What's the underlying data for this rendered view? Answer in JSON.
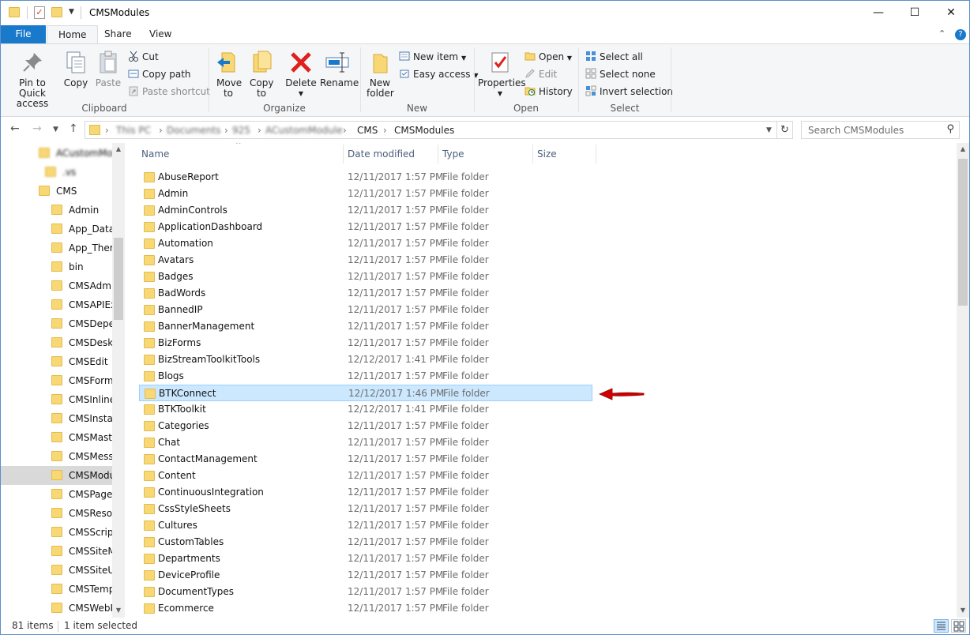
{
  "window": {
    "title": "CMSModules",
    "minimize": "—",
    "maximize": "☐",
    "close": "✕"
  },
  "tabs": {
    "file": "File",
    "home": "Home",
    "share": "Share",
    "view": "View"
  },
  "ribbon": {
    "clipboard": {
      "pin": "Pin to Quick access",
      "copy": "Copy",
      "paste": "Paste",
      "cut": "Cut",
      "copy_path": "Copy path",
      "paste_shortcut": "Paste shortcut",
      "label": "Clipboard"
    },
    "organize": {
      "move_to": "Move to",
      "copy_to": "Copy to",
      "delete": "Delete",
      "rename": "Rename",
      "label": "Organize"
    },
    "new": {
      "new_folder": "New folder",
      "new_item": "New item",
      "easy_access": "Easy access",
      "label": "New"
    },
    "open": {
      "properties": "Properties",
      "open": "Open",
      "edit": "Edit",
      "history": "History",
      "label": "Open"
    },
    "select": {
      "select_all": "Select all",
      "select_none": "Select none",
      "invert": "Invert selection",
      "label": "Select"
    }
  },
  "address": {
    "crumbs": [
      "This PC",
      "Documents",
      "925",
      "ACustomModule",
      "CMS",
      "CMSModules"
    ],
    "search_placeholder": "Search CMSModules"
  },
  "navpane": {
    "items": [
      {
        "label": "ACustomModu",
        "blurred": true
      },
      {
        "label": ".vs",
        "blurred": true
      },
      {
        "label": "CMS"
      },
      {
        "label": "Admin"
      },
      {
        "label": "App_Data"
      },
      {
        "label": "App_Themes"
      },
      {
        "label": "bin"
      },
      {
        "label": "CMSAdminControls"
      },
      {
        "label": "CMSAPIExamples"
      },
      {
        "label": "CMSDependencies"
      },
      {
        "label": "CMSDesk"
      },
      {
        "label": "CMSEdit"
      },
      {
        "label": "CMSFormControls"
      },
      {
        "label": "CMSInlineControls"
      },
      {
        "label": "CMSInstall"
      },
      {
        "label": "CMSMasterPages"
      },
      {
        "label": "CMSMessages"
      },
      {
        "label": "CMSModules",
        "selected": true
      },
      {
        "label": "CMSPages"
      },
      {
        "label": "CMSResources"
      },
      {
        "label": "CMSScripts"
      },
      {
        "label": "CMSSiteManager"
      },
      {
        "label": "CMSSiteUtils"
      },
      {
        "label": "CMSTemplates"
      },
      {
        "label": "CMSWebParts"
      }
    ]
  },
  "columns": {
    "name": "Name",
    "date": "Date modified",
    "type": "Type",
    "size": "Size"
  },
  "files": [
    {
      "name": "AbuseReport",
      "date": "12/11/2017 1:57 PM",
      "type": "File folder"
    },
    {
      "name": "Admin",
      "date": "12/11/2017 1:57 PM",
      "type": "File folder"
    },
    {
      "name": "AdminControls",
      "date": "12/11/2017 1:57 PM",
      "type": "File folder"
    },
    {
      "name": "ApplicationDashboard",
      "date": "12/11/2017 1:57 PM",
      "type": "File folder"
    },
    {
      "name": "Automation",
      "date": "12/11/2017 1:57 PM",
      "type": "File folder"
    },
    {
      "name": "Avatars",
      "date": "12/11/2017 1:57 PM",
      "type": "File folder"
    },
    {
      "name": "Badges",
      "date": "12/11/2017 1:57 PM",
      "type": "File folder"
    },
    {
      "name": "BadWords",
      "date": "12/11/2017 1:57 PM",
      "type": "File folder"
    },
    {
      "name": "BannedIP",
      "date": "12/11/2017 1:57 PM",
      "type": "File folder"
    },
    {
      "name": "BannerManagement",
      "date": "12/11/2017 1:57 PM",
      "type": "File folder"
    },
    {
      "name": "BizForms",
      "date": "12/11/2017 1:57 PM",
      "type": "File folder"
    },
    {
      "name": "BizStreamToolkitTools",
      "date": "12/12/2017 1:41 PM",
      "type": "File folder"
    },
    {
      "name": "Blogs",
      "date": "12/11/2017 1:57 PM",
      "type": "File folder"
    },
    {
      "name": "BTKConnect",
      "date": "12/12/2017 1:46 PM",
      "type": "File folder",
      "selected": true
    },
    {
      "name": "BTKToolkit",
      "date": "12/12/2017 1:41 PM",
      "type": "File folder"
    },
    {
      "name": "Categories",
      "date": "12/11/2017 1:57 PM",
      "type": "File folder"
    },
    {
      "name": "Chat",
      "date": "12/11/2017 1:57 PM",
      "type": "File folder"
    },
    {
      "name": "ContactManagement",
      "date": "12/11/2017 1:57 PM",
      "type": "File folder"
    },
    {
      "name": "Content",
      "date": "12/11/2017 1:57 PM",
      "type": "File folder"
    },
    {
      "name": "ContinuousIntegration",
      "date": "12/11/2017 1:57 PM",
      "type": "File folder"
    },
    {
      "name": "CssStyleSheets",
      "date": "12/11/2017 1:57 PM",
      "type": "File folder"
    },
    {
      "name": "Cultures",
      "date": "12/11/2017 1:57 PM",
      "type": "File folder"
    },
    {
      "name": "CustomTables",
      "date": "12/11/2017 1:57 PM",
      "type": "File folder"
    },
    {
      "name": "Departments",
      "date": "12/11/2017 1:57 PM",
      "type": "File folder"
    },
    {
      "name": "DeviceProfile",
      "date": "12/11/2017 1:57 PM",
      "type": "File folder"
    },
    {
      "name": "DocumentTypes",
      "date": "12/11/2017 1:57 PM",
      "type": "File folder"
    },
    {
      "name": "Ecommerce",
      "date": "12/11/2017 1:57 PM",
      "type": "File folder"
    }
  ],
  "status": {
    "count": "81 items",
    "selected": "1 item selected"
  },
  "colors": {
    "accent": "#1979ca",
    "selection": "#cce8ff",
    "arrow": "#d10000",
    "folder": "#f8d775"
  }
}
